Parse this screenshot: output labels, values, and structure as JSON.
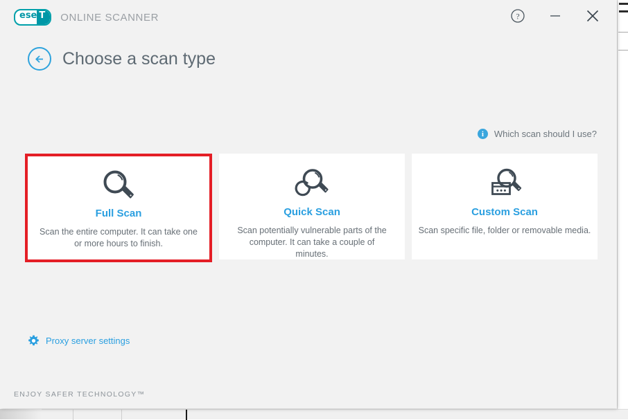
{
  "colors": {
    "brand_teal": "#0097a7",
    "accent_blue": "#2a9fe0",
    "highlight_red": "#e41e26",
    "window_bg": "#f2f2f2",
    "card_bg": "#ffffff",
    "text_gray": "#5e6a73",
    "icon_slate": "#3f4a54"
  },
  "titlebar": {
    "logo_ese": "ese",
    "logo_t": "T",
    "logo_tm": "®",
    "product_name": "ONLINE SCANNER",
    "buttons": [
      {
        "name": "help-button",
        "icon": "help-circle-icon",
        "label": "?"
      },
      {
        "name": "minimize-button",
        "icon": "minimize-icon",
        "label": "–"
      },
      {
        "name": "close-button",
        "icon": "close-icon",
        "label": "✕"
      }
    ]
  },
  "header": {
    "back_icon": "arrow-left-circle-icon",
    "title": "Choose a scan type"
  },
  "help_link": {
    "icon": "info-icon",
    "icon_glyph": "i",
    "label": "Which scan should I use?"
  },
  "cards": [
    {
      "id": "full-scan",
      "icon": "magnifier-icon",
      "title": "Full Scan",
      "description": "Scan the entire computer. It can take one or more hours to finish.",
      "highlighted": true
    },
    {
      "id": "quick-scan",
      "icon": "magnifier-timer-icon",
      "title": "Quick Scan",
      "description": "Scan potentially vulnerable parts of the computer. It can take a couple of minutes.",
      "highlighted": false
    },
    {
      "id": "custom-scan",
      "icon": "magnifier-box-icon",
      "title": "Custom Scan",
      "description": "Scan specific file, folder or removable media.",
      "highlighted": false
    }
  ],
  "proxy_link": {
    "icon": "gear-icon",
    "label": "Proxy server settings"
  },
  "footer": {
    "tagline": "ENJOY SAFER TECHNOLOGY™"
  }
}
